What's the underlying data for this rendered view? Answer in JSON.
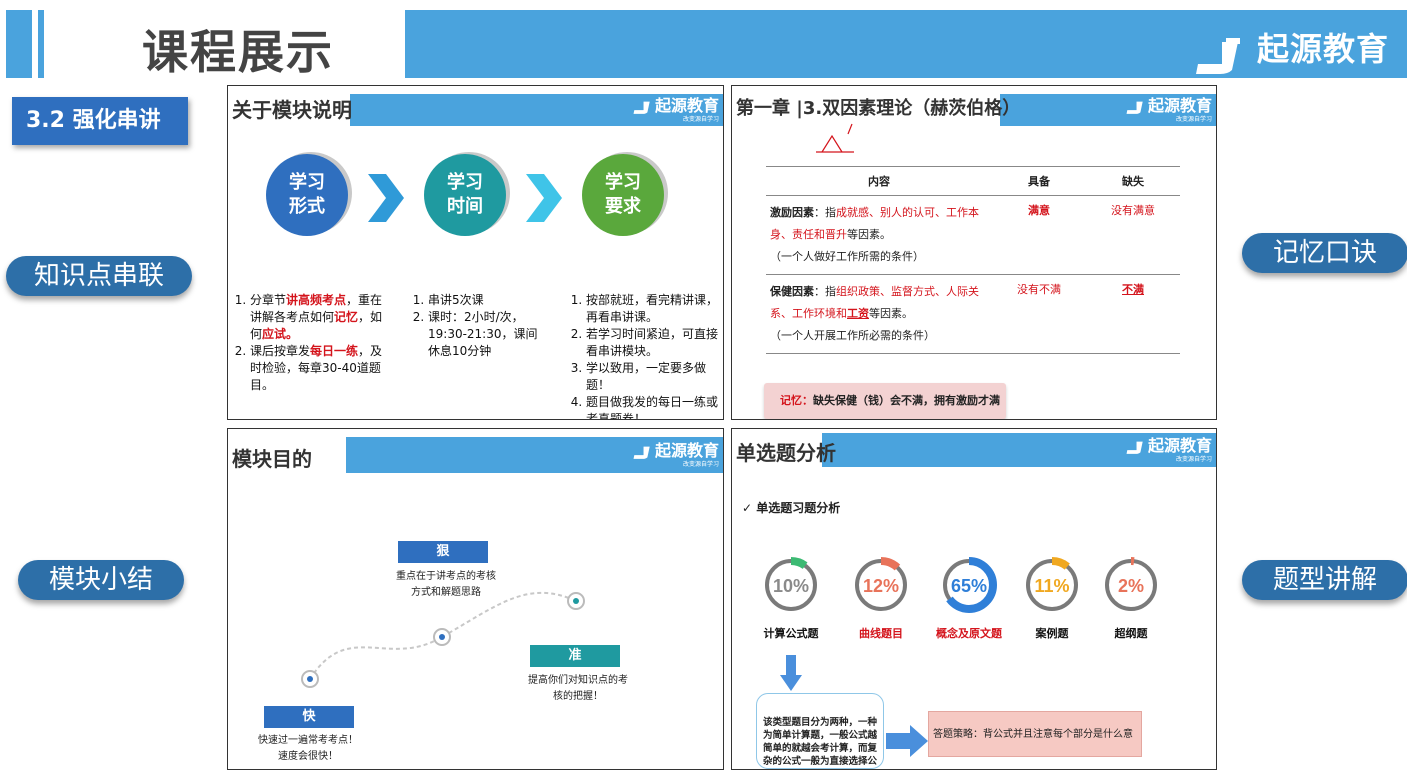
{
  "header": {
    "title": "课程展示",
    "brand_name": "起源教育",
    "brand_slogan": "改变源自学习"
  },
  "section_label": "3.2 强化串讲",
  "side_pills": [
    "知识点串联",
    "模块小结",
    "记忆口诀",
    "题型讲解"
  ],
  "panel1": {
    "title": "关于模块说明",
    "circles": [
      {
        "line1": "学习",
        "line2": "形式",
        "color": "#2f6fbf"
      },
      {
        "line1": "学习",
        "line2": "时间",
        "color": "#1f9aa0"
      },
      {
        "line1": "学习",
        "line2": "要求",
        "color": "#5aa83c"
      }
    ],
    "col1": [
      "分章节",
      "讲高频考点",
      "，重在讲解各考点如何",
      "记忆",
      "，如何",
      "应试。",
      "课后按章发",
      "每日一练",
      "，及时检验，每章30-40道题目。"
    ],
    "col2": [
      "串讲5次课",
      "课时：2小时/次，19:30-21:30，课间休息10分钟"
    ],
    "col3": [
      "按部就班，看完精讲课，再看串讲课。",
      "若学习时间紧迫，可直接看串讲模块。",
      "学以致用，一定要多做题！",
      "题目做我发的每日一练或者真题卷！"
    ]
  },
  "panel2": {
    "title": "第一章 |3.双因素理论（赫茨伯格）",
    "table_headers": [
      "内容",
      "具备",
      "缺失"
    ],
    "row1": {
      "label": "激励因素",
      "lead": "：指",
      "red": "成就感、别人的认可、工作本身、责任和晋升",
      "tail": "等因素。",
      "note": "（一个人做好工作所需的条件）",
      "have": "满意",
      "lack": "没有满意"
    },
    "row2": {
      "label": "保健因素",
      "lead": "：指",
      "red": "组织政策、监督方式、人际关系、工作环境和",
      "red2": "工资",
      "tail": "等因素。",
      "note": "（一个人开展工作所必需的条件）",
      "have": "没有不满",
      "lack": "不满"
    },
    "memo_label": "记忆：",
    "memo_text": "缺失保健（钱）会不满，拥有激励才满意。"
  },
  "panel3": {
    "title": "模块目的",
    "hen": "狠",
    "hen_text": "重点在于讲考点的考核方式和解题思路",
    "zhun": "准",
    "zhun_text": "提高你们对知识点的考核的把握！",
    "kuai": "快",
    "kuai_text": "快速过一遍常考考点！速度会很快！"
  },
  "panel4": {
    "title": "单选题分析",
    "subtitle": "✓ 单选题习题分析",
    "chart_data": {
      "type": "pie",
      "categories": [
        "计算公式题",
        "曲线题目",
        "概念及原文题",
        "案例题",
        "超纲题"
      ],
      "values": [
        10,
        12,
        65,
        11,
        2
      ],
      "colors": [
        "#3cba73",
        "#e8735a",
        "#2f7fd8",
        "#f0a820",
        "#e8735a"
      ],
      "label_colors": [
        "#111",
        "#d4141c",
        "#d4141c",
        "#111",
        "#111"
      ]
    },
    "labels": [
      "10%",
      "12%",
      "65%",
      "11%",
      "2%"
    ],
    "callout": "该类型题目分为两种，一种为简单计算题，一般公式越简单的就越会考计算，而复杂的公式一般为直接选择公式",
    "strategy": "答题策略：背公式并且注意每个部分是什么意思"
  }
}
